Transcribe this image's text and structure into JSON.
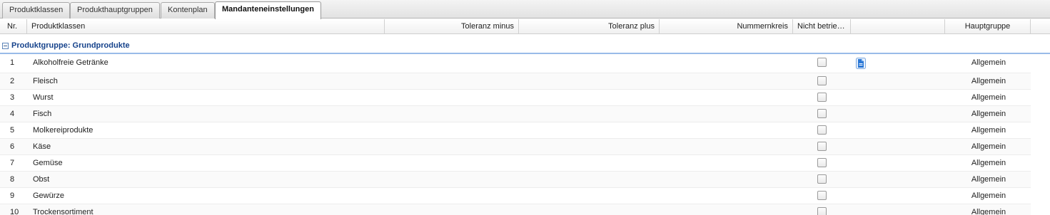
{
  "tabs": [
    {
      "label": "Produktklassen",
      "active": false
    },
    {
      "label": "Produkthauptgruppen",
      "active": false
    },
    {
      "label": "Kontenplan",
      "active": false
    },
    {
      "label": "Mandanteneinstellungen",
      "active": true
    }
  ],
  "columns": {
    "nr": "Nr.",
    "produktklassen": "Produktklassen",
    "toleranz_minus": "Toleranz minus",
    "toleranz_plus": "Toleranz plus",
    "nummernkreis": "Nummernkreis",
    "nicht_betrieben": "Nicht betrie…",
    "blank": "",
    "hauptgruppe": "Hauptgruppe"
  },
  "group": {
    "label": "Produktgruppe: Grundprodukte",
    "toggle_icon": "collapse-minus-icon"
  },
  "rows": [
    {
      "nr": "1",
      "name": "Alkoholfreie Getränke",
      "checked": false,
      "has_doc_icon": true,
      "hauptgruppe": "Allgemein"
    },
    {
      "nr": "2",
      "name": "Fleisch",
      "checked": false,
      "has_doc_icon": false,
      "hauptgruppe": "Allgemein"
    },
    {
      "nr": "3",
      "name": "Wurst",
      "checked": false,
      "has_doc_icon": false,
      "hauptgruppe": "Allgemein"
    },
    {
      "nr": "4",
      "name": "Fisch",
      "checked": false,
      "has_doc_icon": false,
      "hauptgruppe": "Allgemein"
    },
    {
      "nr": "5",
      "name": "Molkereiprodukte",
      "checked": false,
      "has_doc_icon": false,
      "hauptgruppe": "Allgemein"
    },
    {
      "nr": "6",
      "name": "Käse",
      "checked": false,
      "has_doc_icon": false,
      "hauptgruppe": "Allgemein"
    },
    {
      "nr": "7",
      "name": "Gemüse",
      "checked": false,
      "has_doc_icon": false,
      "hauptgruppe": "Allgemein"
    },
    {
      "nr": "8",
      "name": "Obst",
      "checked": false,
      "has_doc_icon": false,
      "hauptgruppe": "Allgemein"
    },
    {
      "nr": "9",
      "name": "Gewürze",
      "checked": false,
      "has_doc_icon": false,
      "hauptgruppe": "Allgemein"
    },
    {
      "nr": "10",
      "name": "Trockensortiment",
      "checked": false,
      "has_doc_icon": false,
      "hauptgruppe": "Allgemein"
    }
  ],
  "colors": {
    "group_text": "#15428b",
    "group_border": "#99bbe8",
    "doc_icon": "#2b78d6"
  }
}
